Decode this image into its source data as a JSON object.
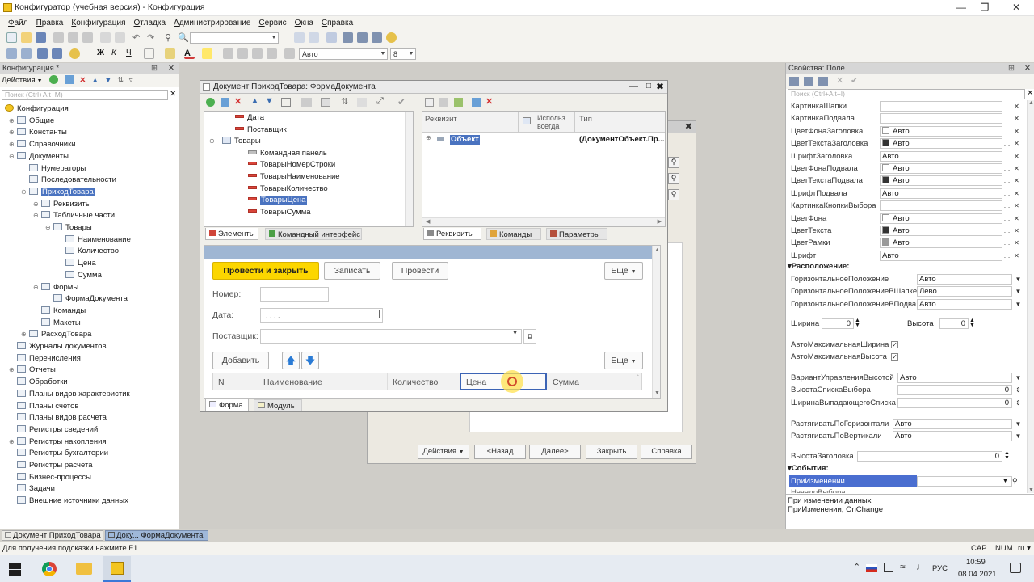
{
  "window": {
    "title": "Конфигуратор (учебная версия) - Конфигурация"
  },
  "menu": {
    "items": [
      "Файл",
      "Правка",
      "Конфигурация",
      "Отладка",
      "Администрирование",
      "Сервис",
      "Окна",
      "Справка"
    ]
  },
  "toolbar": {
    "font_combo": "Авто",
    "size_combo": "8"
  },
  "left_panel": {
    "title": "Конфигурация *",
    "actions_label": "Действия",
    "search_placeholder": "Поиск (Ctrl+Alt+M)",
    "tree": [
      {
        "label": "Конфигурация",
        "level": 0
      },
      {
        "label": "Общие",
        "level": 1,
        "exp": "+"
      },
      {
        "label": "Константы",
        "level": 1,
        "exp": "+"
      },
      {
        "label": "Справочники",
        "level": 1,
        "exp": "+"
      },
      {
        "label": "Документы",
        "level": 1,
        "exp": "−"
      },
      {
        "label": "Нумераторы",
        "level": 2
      },
      {
        "label": "Последовательности",
        "level": 2
      },
      {
        "label": "ПриходТовара",
        "level": 2,
        "exp": "−",
        "selected": true
      },
      {
        "label": "Реквизиты",
        "level": 3,
        "exp": "+"
      },
      {
        "label": "Табличные части",
        "level": 3,
        "exp": "−"
      },
      {
        "label": "Товары",
        "level": 4,
        "exp": "−"
      },
      {
        "label": "Наименование",
        "level": 5
      },
      {
        "label": "Количество",
        "level": 5
      },
      {
        "label": "Цена",
        "level": 5
      },
      {
        "label": "Сумма",
        "level": 5
      },
      {
        "label": "Формы",
        "level": 3,
        "exp": "−"
      },
      {
        "label": "ФормаДокумента",
        "level": 4
      },
      {
        "label": "Команды",
        "level": 3
      },
      {
        "label": "Макеты",
        "level": 3
      },
      {
        "label": "РасходТовара",
        "level": 2,
        "exp": "+"
      },
      {
        "label": "Журналы документов",
        "level": 1
      },
      {
        "label": "Перечисления",
        "level": 1
      },
      {
        "label": "Отчеты",
        "level": 1,
        "exp": "+"
      },
      {
        "label": "Обработки",
        "level": 1
      },
      {
        "label": "Планы видов характеристик",
        "level": 1
      },
      {
        "label": "Планы счетов",
        "level": 1
      },
      {
        "label": "Планы видов расчета",
        "level": 1
      },
      {
        "label": "Регистры сведений",
        "level": 1
      },
      {
        "label": "Регистры накопления",
        "level": 1,
        "exp": "+"
      },
      {
        "label": "Регистры бухгалтерии",
        "level": 1
      },
      {
        "label": "Регистры расчета",
        "level": 1
      },
      {
        "label": "Бизнес-процессы",
        "level": 1
      },
      {
        "label": "Задачи",
        "level": 1
      },
      {
        "label": "Внешние источники данных",
        "level": 1
      }
    ]
  },
  "back_window": {
    "buttons": [
      "Действия",
      "<Назад",
      "Далее>",
      "Закрыть",
      "Справка"
    ]
  },
  "form_window": {
    "title": "Документ ПриходТовара: ФормаДокумента",
    "elements": [
      {
        "label": "Дата",
        "level": 1
      },
      {
        "label": "Поставщик",
        "level": 1
      },
      {
        "label": "Товары",
        "level": 0,
        "exp": "−"
      },
      {
        "label": "Командная панель",
        "level": 2
      },
      {
        "label": "ТоварыНомерСтроки",
        "level": 2
      },
      {
        "label": "ТоварыНаименование",
        "level": 2
      },
      {
        "label": "ТоварыКоличество",
        "level": 2
      },
      {
        "label": "ТоварыЦена",
        "level": 2,
        "selected": true
      },
      {
        "label": "ТоварыСумма",
        "level": 2
      }
    ],
    "left_tabs": [
      "Элементы",
      "Командный интерфейс"
    ],
    "req_headers": [
      "Реквизит",
      "Использ... всегда",
      "Тип"
    ],
    "req_row": {
      "name": "Объект",
      "type": "(ДокументОбъект.Пр..."
    },
    "right_tabs": [
      "Реквизиты",
      "Команды",
      "Параметры"
    ],
    "bottom_tabs": [
      "Форма",
      "Модуль"
    ],
    "preview": {
      "btn_post_close": "Провести и закрыть",
      "btn_save": "Записать",
      "btn_post": "Провести",
      "btn_more": "Еще",
      "label_number": "Номер:",
      "label_date": "Дата:",
      "date_value": ". .     : :",
      "label_supplier": "Поставщик:",
      "btn_add": "Добавить",
      "btn_more2": "Еще",
      "columns": [
        "N",
        "Наименование",
        "Количество",
        "Цена",
        "Сумма"
      ]
    }
  },
  "properties": {
    "title": "Свойства: Поле",
    "search_placeholder": "Поиск (Ctrl+Alt+I)",
    "rows_top": [
      {
        "name": "КартинкаШапки",
        "value": ""
      },
      {
        "name": "КартинкаПодвала",
        "value": ""
      },
      {
        "name": "ЦветФонаЗаголовка",
        "value": "Авто",
        "swatch": "#ffffff"
      },
      {
        "name": "ЦветТекстаЗаголовка",
        "value": "Авто",
        "swatch": "#333333"
      },
      {
        "name": "ШрифтЗаголовка",
        "value": "Авто"
      },
      {
        "name": "ЦветФонаПодвала",
        "value": "Авто",
        "swatch": "#ffffff"
      },
      {
        "name": "ЦветТекстаПодвала",
        "value": "Авто",
        "swatch": "#333333"
      },
      {
        "name": "ШрифтПодвала",
        "value": "Авто"
      },
      {
        "name": "КартинкаКнопкиВыбора",
        "value": ""
      },
      {
        "name": "ЦветФона",
        "value": "Авто",
        "swatch": "#ffffff"
      },
      {
        "name": "ЦветТекста",
        "value": "Авто",
        "swatch": "#333333"
      },
      {
        "name": "ЦветРамки",
        "value": "Авто",
        "swatch": "#9a9a9a"
      },
      {
        "name": "Шрифт",
        "value": "Авто"
      }
    ],
    "section_layout": "Расположение:",
    "layout_rows": [
      {
        "name": "ГоризонтальноеПоложение",
        "value": "Авто"
      },
      {
        "name": "ГоризонтальноеПоложениеВШапке",
        "value": "Лево"
      },
      {
        "name": "ГоризонтальноеПоложениеВПодвале",
        "value": "Авто"
      }
    ],
    "width_label": "Ширина",
    "width_value": "0",
    "height_label": "Высота",
    "height_value": "0",
    "auto_max_width": "АвтоМаксимальнаяШирина",
    "auto_max_height": "АвтоМаксимальнаяВысота",
    "rows_mid": [
      {
        "name": "ВариантУправленияВысотой",
        "value": "Авто"
      },
      {
        "name": "ВысотаСпискаВыбора",
        "value": "0"
      },
      {
        "name": "ШиринаВыпадающегоСписка",
        "value": "0"
      }
    ],
    "stretch_rows": [
      {
        "name": "РастягиватьПоГоризонтали",
        "value": "Авто"
      },
      {
        "name": "РастягиватьПоВертикали",
        "value": "Авто"
      }
    ],
    "header_height_label": "ВысотаЗаголовка",
    "header_height_value": "0",
    "section_events": "События:",
    "event_selected": "ПриИзменении",
    "event_next": "НачалоВыбора",
    "description_line1": "При изменении данных",
    "description_line2": "ПриИзменении, OnChange"
  },
  "bottom_tabs": [
    "Документ ПриходТовара",
    "Доку... ФормаДокумента"
  ],
  "status": {
    "hint": "Для получения подсказки нажмите F1",
    "caps": "CAP",
    "num": "NUM",
    "lang_mode": "ru ▾"
  },
  "taskbar": {
    "lang": "РУС",
    "time": "10:59",
    "date": "08.04.2021"
  }
}
